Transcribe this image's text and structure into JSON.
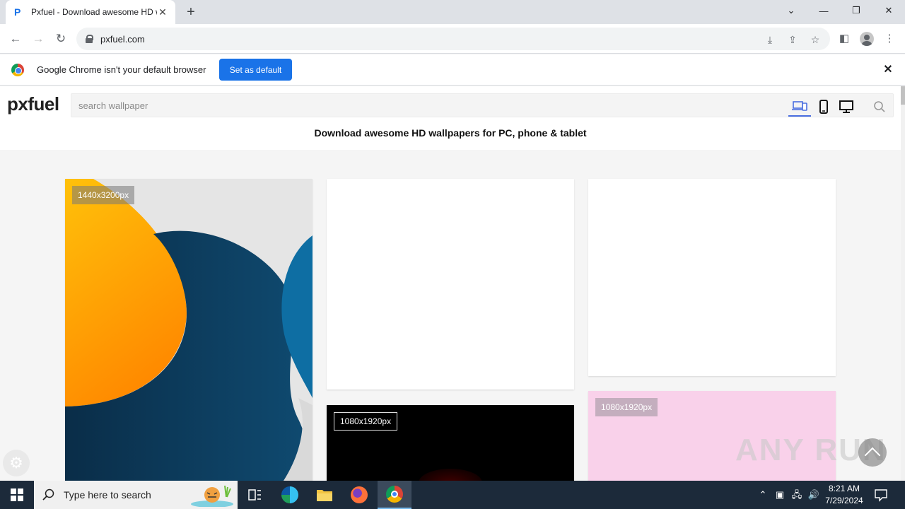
{
  "browser": {
    "tab_title": "Pxfuel - Download awesome HD wallpapers for PC, phone & tablet",
    "url": "pxfuel.com",
    "infobar_text": "Google Chrome isn't your default browser",
    "set_default_label": "Set as default"
  },
  "site": {
    "logo": "pxfuel",
    "search_placeholder": "search wallpaper",
    "tagline": "Download awesome HD wallpapers for PC, phone & tablet"
  },
  "cards": [
    {
      "resolution": "1440x3200px"
    },
    {
      "resolution": ""
    },
    {
      "resolution": ""
    },
    {
      "resolution": "1080x1920px"
    },
    {
      "resolution": "1080x1920px"
    }
  ],
  "watermark": "ANY RUN",
  "taskbar": {
    "search_text": "Type here to search",
    "time": "8:21 AM",
    "date": "7/29/2024"
  },
  "colors": {
    "accent": "#1a73e8",
    "taskbar": "#1c2a3a",
    "active_device": "#4a6ee0"
  }
}
